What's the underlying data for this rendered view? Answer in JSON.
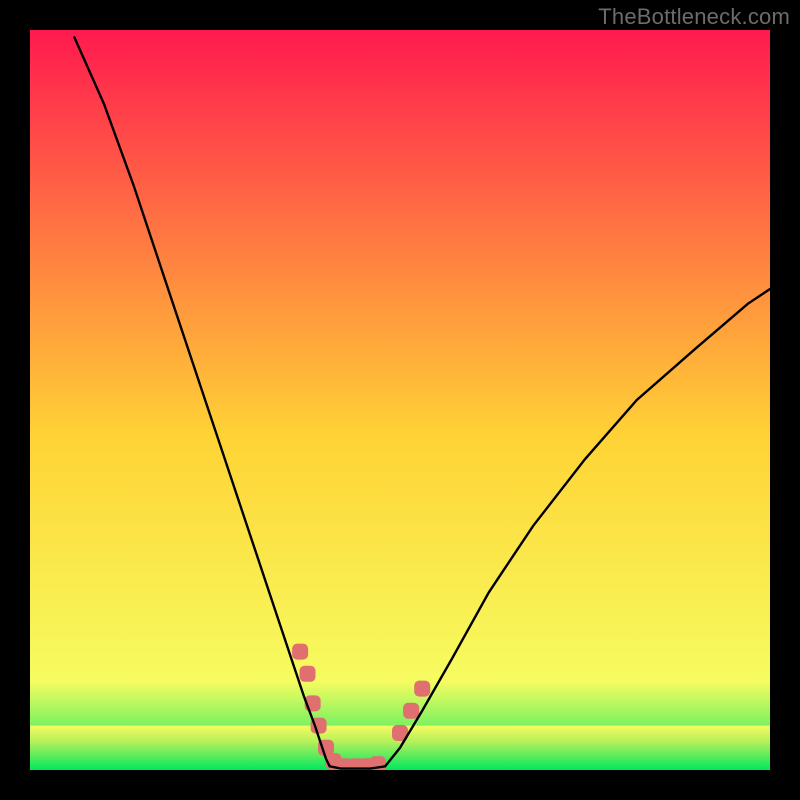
{
  "watermark": "TheBottleneck.com",
  "chart_data": {
    "type": "line",
    "title": "",
    "xlabel": "",
    "ylabel": "",
    "xlim": [
      0,
      100
    ],
    "ylim": [
      0,
      100
    ],
    "grid": false,
    "background": {
      "type": "vertical-gradient",
      "top_color": "#ff1a4f",
      "mid_color": "#ffd335",
      "bottom_color": "#00e85f"
    },
    "series": [
      {
        "name": "left-branch",
        "color": "#000000",
        "x": [
          6,
          10,
          14,
          18,
          22,
          26,
          30,
          33,
          35,
          37,
          38.5,
          39.5,
          40,
          40.5
        ],
        "y": [
          99,
          90,
          79,
          67,
          55,
          43,
          31,
          22,
          16,
          10,
          6,
          3,
          1.5,
          0.5
        ]
      },
      {
        "name": "right-branch",
        "color": "#000000",
        "x": [
          48,
          50,
          53,
          57,
          62,
          68,
          75,
          82,
          90,
          97,
          100
        ],
        "y": [
          0.5,
          3,
          8,
          15,
          24,
          33,
          42,
          50,
          57,
          63,
          65
        ]
      },
      {
        "name": "valley-floor",
        "color": "#000000",
        "x": [
          40.5,
          42,
          44,
          46,
          48
        ],
        "y": [
          0.5,
          0.2,
          0.2,
          0.2,
          0.5
        ]
      }
    ],
    "markers": [
      {
        "name": "left-cluster",
        "color": "#e07070",
        "shape": "rounded-square",
        "points": [
          [
            36.5,
            16
          ],
          [
            37.5,
            13
          ],
          [
            38.2,
            9
          ],
          [
            39,
            6
          ],
          [
            40,
            3
          ],
          [
            41,
            1.2
          ],
          [
            42.5,
            0.5
          ],
          [
            44,
            0.5
          ],
          [
            45.5,
            0.5
          ],
          [
            47,
            0.8
          ]
        ]
      },
      {
        "name": "right-cluster",
        "color": "#e07070",
        "shape": "rounded-square",
        "points": [
          [
            50,
            5
          ],
          [
            51.5,
            8
          ],
          [
            53,
            11
          ]
        ]
      }
    ],
    "green_band": {
      "y_top": 6,
      "y_bottom": 0,
      "core_color": "#00e85f",
      "fade_top_color": "#f6fc60"
    }
  }
}
